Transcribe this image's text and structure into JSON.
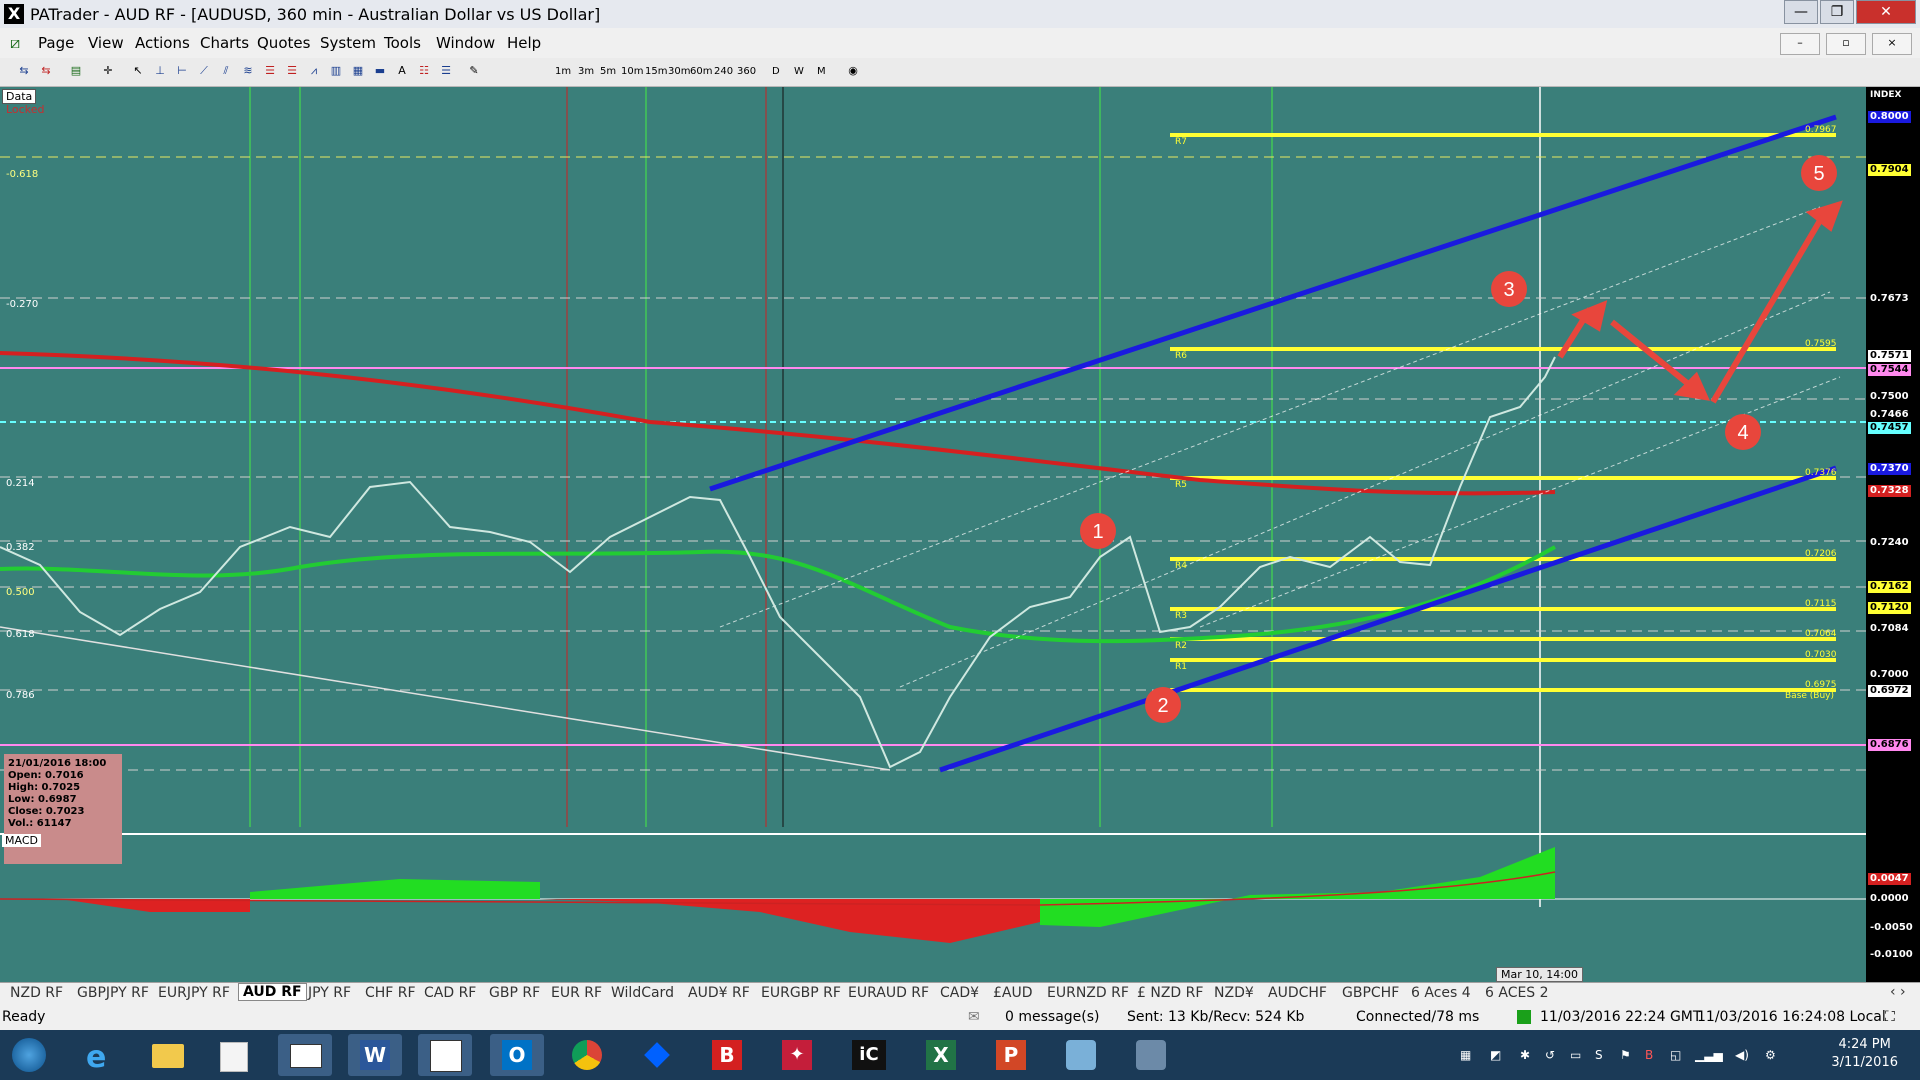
{
  "window": {
    "title": "PATrader - AUD RF - [AUDUSD, 360 min - Australian Dollar vs US Dollar]",
    "app_icon": "X",
    "buttons": [
      "—",
      "❐",
      "✕"
    ]
  },
  "menu": [
    "Page",
    "View",
    "Actions",
    "Charts",
    "Quotes",
    "System",
    "Tools",
    "Window",
    "Help"
  ],
  "mdi_buttons": [
    "–",
    "▫",
    "×"
  ],
  "timeframes": [
    "1m",
    "3m",
    "5m",
    "10m",
    "15m",
    "30m",
    "60m",
    "240",
    "360",
    "D",
    "W",
    "M"
  ],
  "chart": {
    "data_label": "Data",
    "locked_label": "Locked",
    "fib_labels": [
      "-0.618",
      "-0.270",
      "0.214",
      "0.382",
      "0.500",
      "0.618",
      "0.786"
    ],
    "price_labels": [
      "INDEX",
      "0.8000",
      "0.7904",
      "0.7673",
      "0.7571",
      "0.7544",
      "0.7500",
      "0.7466",
      "0.7457",
      "0.7370",
      "0.7328",
      "0.7240",
      "0.7162",
      "0.7120",
      "0.7084",
      "0.7000",
      "0.6972",
      "0.6876"
    ],
    "pivot_labels": [
      "R7",
      "R6",
      "R5",
      "R4",
      "R3",
      "R2",
      "R1",
      "Base (Buy)"
    ],
    "pivot_values": [
      "0.7967",
      "0.7595",
      "0.7376",
      "0.7206",
      "0.7115",
      "0.7064",
      "0.7030",
      "0.6975"
    ],
    "wave_labels": [
      "1",
      "2",
      "3",
      "4",
      "5"
    ],
    "info_box": {
      "date": "21/01/2016 18:00",
      "open": "Open: 0.7016",
      "high": "High: 0.7025",
      "low": "Low: 0.6987",
      "close": "Close: 0.7023",
      "vol": "Vol.: 61147"
    },
    "macd_label": "MACD",
    "macd_axis": [
      "0.0047",
      "0.0000",
      "-0.0050",
      "-0.0100"
    ],
    "date_tooltip": "Mar 10, 14:00",
    "colors": {
      "background": "#3a7f7a",
      "channel": "#1a1adf",
      "ma_red": "#d42020",
      "ma_green": "#22cc33",
      "fib_yellow": "#ffff33",
      "pink": "#ff88ee",
      "cyan": "#66ffff",
      "arrow": "#e8463c"
    }
  },
  "tabs": [
    "NZD RF",
    "GBPJPY RF",
    "EURJPY RF",
    "AUD RF",
    "JPY RF",
    "CHF RF",
    "CAD RF",
    "GBP RF",
    "EUR RF",
    "WildCard",
    "AUD¥ RF",
    "EURGBP RF",
    "EURAUD RF",
    "CAD¥",
    "£AUD",
    "EURNZD RF",
    "£ NZD RF",
    "NZD¥",
    "AUDCHF",
    "GBPCHF",
    "6 Aces 4",
    "6 ACES 2"
  ],
  "active_tab": "AUD RF",
  "status": {
    "ready": "Ready",
    "messages": "0 message(s)",
    "sent": "Sent: 13 Kb/Recv: 524 Kb",
    "connected": "Connected/78 ms",
    "gmt": "11/03/2016 22:24 GMT",
    "local": "11/03/2016 16:24:08 Local"
  },
  "taskbar": {
    "time": "4:24 PM",
    "date": "3/11/2016"
  }
}
